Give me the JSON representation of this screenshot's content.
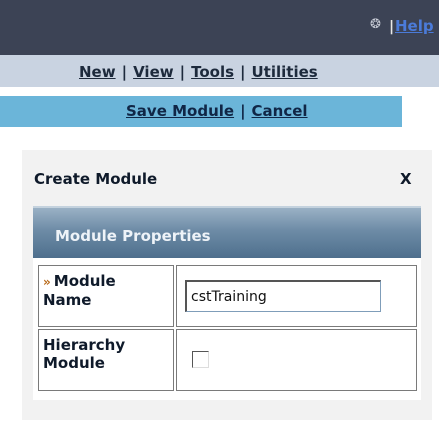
{
  "header": {
    "separator": "|",
    "help_label": "Help"
  },
  "menu": {
    "items": [
      "New",
      "View",
      "Tools",
      "Utilities"
    ],
    "separator": "|"
  },
  "actions": {
    "save_label": "Save Module",
    "cancel_label": "Cancel",
    "separator": "|"
  },
  "dialog": {
    "title": "Create Module",
    "close_label": "X",
    "section_title": "Module Properties",
    "fields": [
      {
        "label": "Module Name",
        "required_marker": "»",
        "value": "cstTraining"
      },
      {
        "label": "Hierarchy Module",
        "checked": false
      }
    ]
  }
}
